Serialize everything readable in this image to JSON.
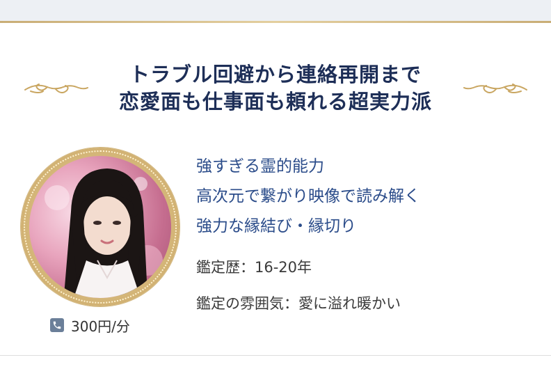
{
  "headline": {
    "line1": "トラブル回避から連絡再開まで",
    "line2": "恋愛面も仕事面も頼れる超実力派"
  },
  "features": [
    "強すぎる霊的能力",
    "高次元で繋がり映像で読み解く",
    "強力な縁結び・縁切り"
  ],
  "info": {
    "experience": "鑑定歴：16-20年",
    "atmosphere": "鑑定の雰囲気：愛に溢れ暖かい"
  },
  "price": {
    "icon": "phone-icon",
    "text": "300円/分"
  },
  "colors": {
    "headline": "#1d2e57",
    "features": "#2b4c8a",
    "gold": "#c9ad76"
  }
}
